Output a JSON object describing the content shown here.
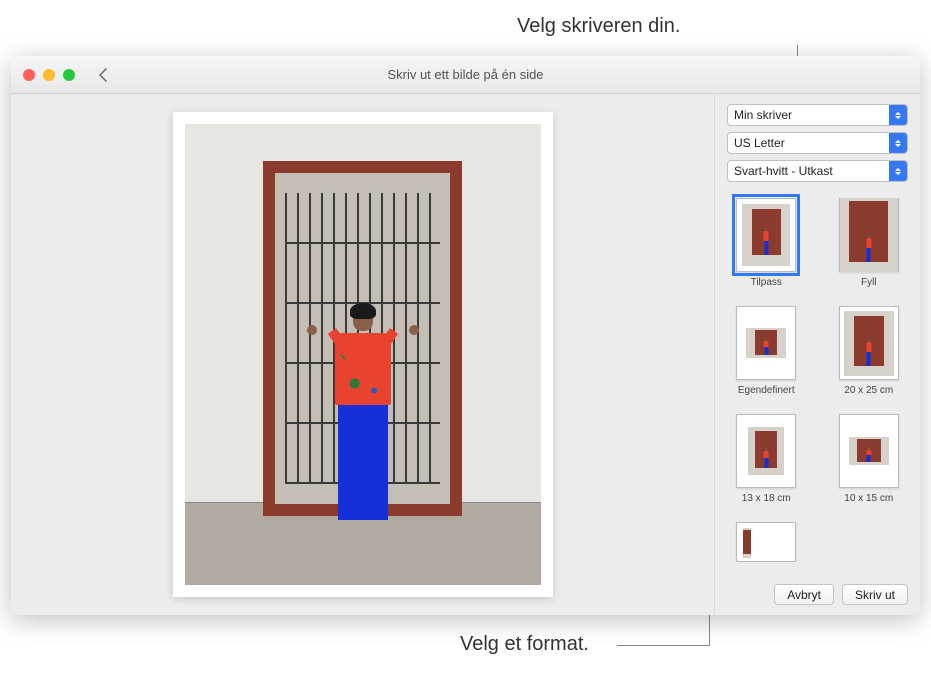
{
  "callouts": {
    "top": "Velg skriveren din.",
    "bottom": "Velg et format."
  },
  "window": {
    "title": "Skriv ut ett bilde på én side"
  },
  "selects": {
    "printer": "Min skriver",
    "paper": "US Letter",
    "quality": "Svart-hvitt - Utkast"
  },
  "formats": [
    {
      "label": "Tilpass",
      "selected": true
    },
    {
      "label": "Fyll",
      "selected": false
    },
    {
      "label": "Egendefinert",
      "selected": false
    },
    {
      "label": "20 x 25 cm",
      "selected": false
    },
    {
      "label": "13 x 18 cm",
      "selected": false
    },
    {
      "label": "10 x 15 cm",
      "selected": false
    },
    {
      "label": "",
      "selected": false
    }
  ],
  "actions": {
    "cancel": "Avbryt",
    "print": "Skriv ut"
  }
}
